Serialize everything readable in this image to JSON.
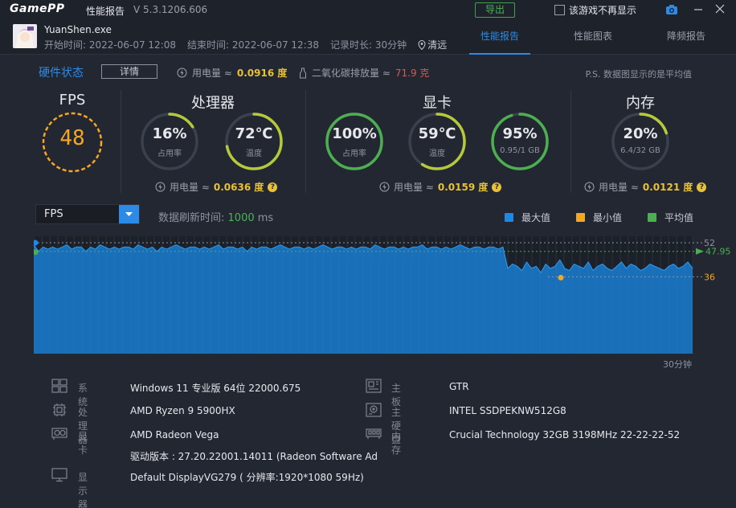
{
  "titlebar": {
    "logo": "GamePP",
    "title": "性能报告",
    "version": "V 5.3.1206.606",
    "export_label": "导出",
    "no_show_label": "该游戏不再显示"
  },
  "info": {
    "process": "YuanShen.exe",
    "start": "开始时间: 2022-06-07 12:08",
    "end": "结束时间: 2022-06-07 12:38",
    "duration": "记录时长: 30分钟",
    "location": "清远"
  },
  "tabs": [
    {
      "label": "性能报告",
      "active": true
    },
    {
      "label": "性能图表",
      "active": false
    },
    {
      "label": "降频报告",
      "active": false
    }
  ],
  "hardware": {
    "title": "硬件状态",
    "detail_label": "详情",
    "power_label": "用电量 ≈",
    "power_value": "0.0916 度",
    "co2_label": "二氧化碳排放量 ≈",
    "co2_value": "71.9 克",
    "note": "P.S. 数据图显示的是平均值"
  },
  "sections": {
    "fps": {
      "title": "FPS",
      "value": "48"
    },
    "cpu": {
      "title": "处理器",
      "usage": {
        "value": "16%",
        "label": "占用率",
        "pct": 16
      },
      "temp": {
        "value": "72℃",
        "label": "温度",
        "pct": 72
      },
      "power_label": "用电量 ≈",
      "power_value": "0.0636 度"
    },
    "gpu": {
      "title": "显卡",
      "usage": {
        "value": "100%",
        "label": "占用率",
        "pct": 100
      },
      "temp": {
        "value": "59℃",
        "label": "温度",
        "pct": 59
      },
      "mem": {
        "value": "95%",
        "label": "0.95/1 GB",
        "pct": 95
      },
      "power_label": "用电量 ≈",
      "power_value": "0.0159 度"
    },
    "ram": {
      "title": "内存",
      "usage": {
        "value": "20%",
        "label": "6.4/32 GB",
        "pct": 20
      },
      "power_label": "用电量 ≈",
      "power_value": "0.0121 度"
    }
  },
  "chart_panel": {
    "select_label": "FPS",
    "refresh_label": "数据刷新时间:",
    "refresh_value": "1000",
    "refresh_unit": "ms",
    "legend": [
      {
        "label": "最大值",
        "color": "#1e88e5"
      },
      {
        "label": "最小值",
        "color": "#f5a623"
      },
      {
        "label": "平均值",
        "color": "#4caf50"
      }
    ],
    "max_label": "52",
    "avg_label": "47.95",
    "min_label": "36",
    "time_label": "30分钟"
  },
  "chart_data": {
    "type": "area",
    "series": [
      {
        "values": [
          51,
          48,
          50,
          49,
          50,
          49,
          50,
          51,
          49,
          50,
          50,
          48,
          50,
          49,
          51,
          50,
          49,
          50,
          49,
          50,
          50,
          49,
          51,
          50,
          49,
          50,
          48,
          50,
          49,
          50,
          51,
          50,
          49,
          50,
          50,
          49,
          50,
          49,
          50,
          51,
          49,
          50,
          50,
          49,
          50,
          48,
          50,
          49,
          50,
          50,
          49,
          50,
          51,
          50,
          49,
          50,
          50,
          49,
          50,
          49,
          50,
          51,
          50,
          49,
          50,
          50,
          49,
          50,
          49,
          50,
          50,
          49,
          51,
          50,
          49,
          50,
          50,
          49,
          50,
          49,
          50,
          50,
          51,
          49,
          50,
          50,
          49,
          50,
          49,
          50,
          51,
          50,
          49,
          50,
          50,
          49,
          50,
          50,
          49,
          50,
          40,
          42,
          41,
          39,
          43,
          40,
          41,
          38,
          42,
          40,
          41,
          44,
          40,
          39,
          42,
          41,
          40,
          43,
          39,
          41,
          42,
          40,
          39,
          41,
          43,
          40,
          42,
          41,
          39,
          40,
          42,
          41,
          40,
          39,
          41,
          42,
          40,
          41,
          43,
          40
        ]
      }
    ],
    "max": 52,
    "min": 36,
    "avg": 47.95,
    "ylim": [
      0,
      55
    ]
  },
  "specs": [
    {
      "key": "系　统",
      "value": "Windows 11 专业版 64位   22000.675",
      "icon": "windows-icon"
    },
    {
      "key": "处理器",
      "value": "AMD Ryzen 9 5900HX",
      "icon": "cpu-icon"
    },
    {
      "key": "显卡",
      "value": "AMD Radeon Vega",
      "icon": "gpu-icon"
    },
    {
      "key": "",
      "value": "驱动版本 : 27.20.22001.14011 (Radeon Software Ad",
      "icon": ""
    },
    {
      "key": "显示器",
      "value": "Default DisplayVG279 ( 分辨率:1920*1080 59Hz)",
      "icon": "monitor-icon"
    },
    {
      "key": "主板",
      "value": "GTR",
      "icon": "motherboard-icon"
    },
    {
      "key": "主硬盘",
      "value": "INTEL SSDPEKNW512G8",
      "icon": "disk-icon"
    },
    {
      "key": "内存",
      "value": "Crucial Technology 32GB 3198MHz 22-22-22-52",
      "icon": "ram-icon"
    }
  ]
}
